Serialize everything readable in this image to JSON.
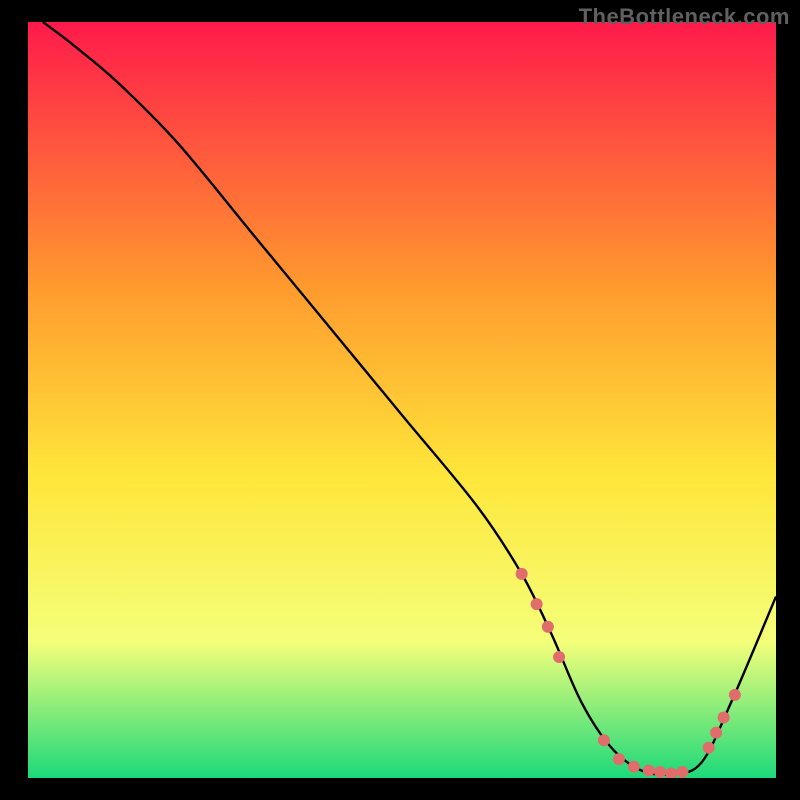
{
  "watermark": "TheBottleneck.com",
  "chart_data": {
    "type": "line",
    "title": "",
    "xlabel": "",
    "ylabel": "",
    "xlim": [
      0,
      100
    ],
    "ylim": [
      0,
      100
    ],
    "background_gradient": {
      "top": "#ff1a4b",
      "upper_mid": "#ff9a2e",
      "mid": "#ffe63a",
      "lower_mid": "#f4ff7a",
      "bottom": "#1cd97a"
    },
    "series": [
      {
        "name": "curve",
        "x": [
          2,
          6,
          12,
          20,
          30,
          40,
          50,
          60,
          66,
          70,
          74,
          78,
          82,
          86,
          90,
          94,
          100
        ],
        "y": [
          100,
          97,
          92,
          84,
          72,
          60,
          48,
          36,
          27,
          19,
          10,
          4,
          1,
          0.5,
          2,
          10,
          24
        ],
        "stroke": "#000000",
        "stroke_width": 2.4
      }
    ],
    "points": [
      {
        "x": 66,
        "y": 27,
        "color": "#e06c6c",
        "r": 6
      },
      {
        "x": 68,
        "y": 23,
        "color": "#e06c6c",
        "r": 6
      },
      {
        "x": 69.5,
        "y": 20,
        "color": "#e06c6c",
        "r": 6
      },
      {
        "x": 71,
        "y": 16,
        "color": "#e06c6c",
        "r": 6
      },
      {
        "x": 77,
        "y": 5,
        "color": "#e06c6c",
        "r": 6
      },
      {
        "x": 79,
        "y": 2.5,
        "color": "#e06c6c",
        "r": 6
      },
      {
        "x": 81,
        "y": 1.5,
        "color": "#e06c6c",
        "r": 6
      },
      {
        "x": 83,
        "y": 1,
        "color": "#e06c6c",
        "r": 6
      },
      {
        "x": 84.5,
        "y": 0.8,
        "color": "#e06c6c",
        "r": 6
      },
      {
        "x": 86,
        "y": 0.6,
        "color": "#e06c6c",
        "r": 6
      },
      {
        "x": 87.5,
        "y": 0.8,
        "color": "#e06c6c",
        "r": 6
      },
      {
        "x": 91,
        "y": 4,
        "color": "#e06c6c",
        "r": 6
      },
      {
        "x": 92,
        "y": 6,
        "color": "#e06c6c",
        "r": 6
      },
      {
        "x": 93,
        "y": 8,
        "color": "#e06c6c",
        "r": 6
      },
      {
        "x": 94.5,
        "y": 11,
        "color": "#e06c6c",
        "r": 6
      }
    ]
  }
}
